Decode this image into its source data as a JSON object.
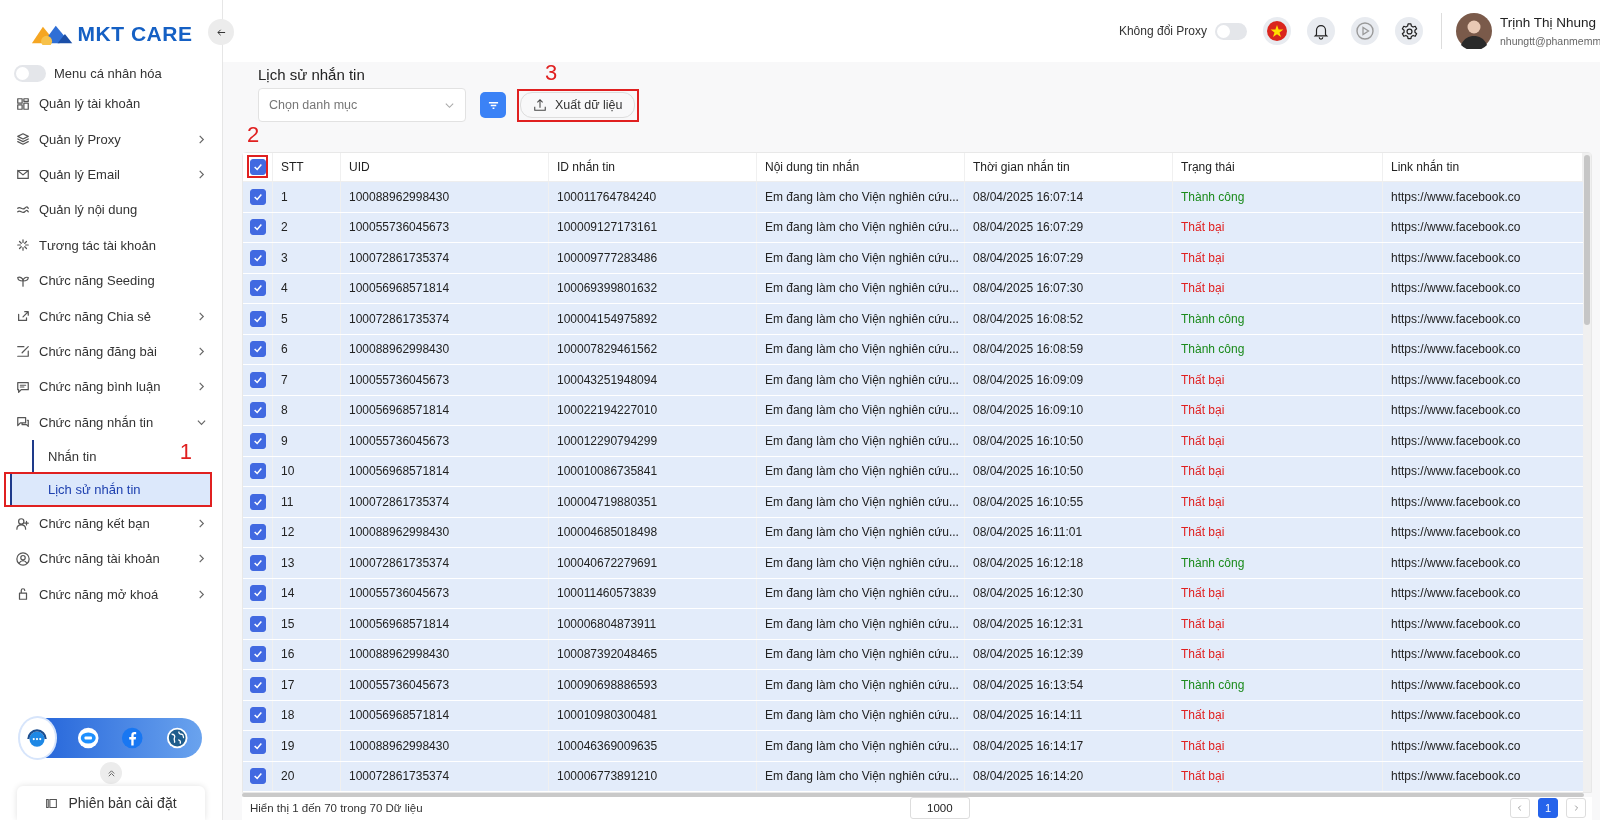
{
  "sidebar": {
    "logo": "MKT CARE",
    "personal_menu": {
      "label": "Menu cá nhân hóa",
      "on": false
    },
    "items": [
      {
        "label": "Quản lý tài khoản",
        "expandable": false
      },
      {
        "label": "Quản lý Proxy",
        "expandable": true,
        "expanded": false
      },
      {
        "label": "Quản lý Email",
        "expandable": true,
        "expanded": false
      },
      {
        "label": "Quản lý nội dung",
        "expandable": false
      },
      {
        "label": "Tương tác tài khoản",
        "expandable": false
      },
      {
        "label": "Chức năng Seeding",
        "expandable": false
      },
      {
        "label": "Chức năng Chia sẻ",
        "expandable": true,
        "expanded": false
      },
      {
        "label": "Chức năng đăng bài",
        "expandable": true,
        "expanded": false
      },
      {
        "label": "Chức năng bình luận",
        "expandable": true,
        "expanded": false
      },
      {
        "label": "Chức năng nhắn tin",
        "expandable": true,
        "expanded": true,
        "children": [
          {
            "label": "Nhắn tin",
            "selected": false
          },
          {
            "label": "Lịch sử nhắn tin",
            "selected": true,
            "callout": "1"
          }
        ]
      },
      {
        "label": "Chức năng kết bạn",
        "expandable": true,
        "expanded": false
      },
      {
        "label": "Chức năng tài khoản",
        "expandable": true,
        "expanded": false
      },
      {
        "label": "Chức năng mở khoá",
        "expandable": true,
        "expanded": false
      }
    ],
    "version_label": "Phiên bản cài đặt"
  },
  "header": {
    "proxy_toggle": {
      "label": "Không đổi Proxy",
      "on": false
    },
    "user": {
      "name": "Trịnh Thị Nhung",
      "email": "nhungtt@phanmemm"
    }
  },
  "page": {
    "title": "Lịch sử nhắn tin",
    "category_select": {
      "placeholder": "Chọn danh mục"
    },
    "export_button": {
      "label": "Xuất dữ liệu",
      "callout": "3"
    }
  },
  "table": {
    "select_all": {
      "checked": true,
      "callout": "2"
    },
    "columns": [
      "STT",
      "UID",
      "ID nhắn tin",
      "Nội dung tin nhắn",
      "Thời gian nhắn tin",
      "Trạng thái",
      "Link nhắn tin"
    ],
    "rows": [
      {
        "checked": true,
        "stt": "1",
        "uid": "100088962998430",
        "msg_id": "100011764784240",
        "content": "Em đang làm cho Viện nghiên cứu...",
        "time": "08/04/2025 16:07:14",
        "status": "Thành công",
        "ok": true,
        "link": "https://www.facebook.co"
      },
      {
        "checked": true,
        "stt": "2",
        "uid": "100055736045673",
        "msg_id": "100009127173161",
        "content": "Em đang làm cho Viện nghiên cứu...",
        "time": "08/04/2025 16:07:29",
        "status": "Thất bại",
        "ok": false,
        "link": "https://www.facebook.co"
      },
      {
        "checked": true,
        "stt": "3",
        "uid": "100072861735374",
        "msg_id": "100009777283486",
        "content": "Em đang làm cho Viện nghiên cứu...",
        "time": "08/04/2025 16:07:29",
        "status": "Thất bại",
        "ok": false,
        "link": "https://www.facebook.co"
      },
      {
        "checked": true,
        "stt": "4",
        "uid": "100056968571814",
        "msg_id": "100069399801632",
        "content": "Em đang làm cho Viện nghiên cứu...",
        "time": "08/04/2025 16:07:30",
        "status": "Thất bại",
        "ok": false,
        "link": "https://www.facebook.co"
      },
      {
        "checked": true,
        "stt": "5",
        "uid": "100072861735374",
        "msg_id": "100004154975892",
        "content": "Em đang làm cho Viện nghiên cứu...",
        "time": "08/04/2025 16:08:52",
        "status": "Thành công",
        "ok": true,
        "link": "https://www.facebook.co"
      },
      {
        "checked": true,
        "stt": "6",
        "uid": "100088962998430",
        "msg_id": "100007829461562",
        "content": "Em đang làm cho Viện nghiên cứu...",
        "time": "08/04/2025 16:08:59",
        "status": "Thành công",
        "ok": true,
        "link": "https://www.facebook.co"
      },
      {
        "checked": true,
        "stt": "7",
        "uid": "100055736045673",
        "msg_id": "100043251948094",
        "content": "Em đang làm cho Viện nghiên cứu...",
        "time": "08/04/2025 16:09:09",
        "status": "Thất bại",
        "ok": false,
        "link": "https://www.facebook.co"
      },
      {
        "checked": true,
        "stt": "8",
        "uid": "100056968571814",
        "msg_id": "100022194227010",
        "content": "Em đang làm cho Viện nghiên cứu...",
        "time": "08/04/2025 16:09:10",
        "status": "Thất bại",
        "ok": false,
        "link": "https://www.facebook.co"
      },
      {
        "checked": true,
        "stt": "9",
        "uid": "100055736045673",
        "msg_id": "100012290794299",
        "content": "Em đang làm cho Viện nghiên cứu...",
        "time": "08/04/2025 16:10:50",
        "status": "Thất bại",
        "ok": false,
        "link": "https://www.facebook.co"
      },
      {
        "checked": true,
        "stt": "10",
        "uid": "100056968571814",
        "msg_id": "100010086735841",
        "content": "Em đang làm cho Viện nghiên cứu...",
        "time": "08/04/2025 16:10:50",
        "status": "Thất bại",
        "ok": false,
        "link": "https://www.facebook.co"
      },
      {
        "checked": true,
        "stt": "11",
        "uid": "100072861735374",
        "msg_id": "100004719880351",
        "content": "Em đang làm cho Viện nghiên cứu...",
        "time": "08/04/2025 16:10:55",
        "status": "Thất bại",
        "ok": false,
        "link": "https://www.facebook.co"
      },
      {
        "checked": true,
        "stt": "12",
        "uid": "100088962998430",
        "msg_id": "100004685018498",
        "content": "Em đang làm cho Viện nghiên cứu...",
        "time": "08/04/2025 16:11:01",
        "status": "Thất bại",
        "ok": false,
        "link": "https://www.facebook.co"
      },
      {
        "checked": true,
        "stt": "13",
        "uid": "100072861735374",
        "msg_id": "100040672279691",
        "content": "Em đang làm cho Viện nghiên cứu...",
        "time": "08/04/2025 16:12:18",
        "status": "Thành công",
        "ok": true,
        "link": "https://www.facebook.co"
      },
      {
        "checked": true,
        "stt": "14",
        "uid": "100055736045673",
        "msg_id": "100011460573839",
        "content": "Em đang làm cho Viện nghiên cứu...",
        "time": "08/04/2025 16:12:30",
        "status": "Thất bại",
        "ok": false,
        "link": "https://www.facebook.co"
      },
      {
        "checked": true,
        "stt": "15",
        "uid": "100056968571814",
        "msg_id": "100006804873911",
        "content": "Em đang làm cho Viện nghiên cứu...",
        "time": "08/04/2025 16:12:31",
        "status": "Thất bại",
        "ok": false,
        "link": "https://www.facebook.co"
      },
      {
        "checked": true,
        "stt": "16",
        "uid": "100088962998430",
        "msg_id": "100087392048465",
        "content": "Em đang làm cho Viện nghiên cứu...",
        "time": "08/04/2025 16:12:39",
        "status": "Thất bại",
        "ok": false,
        "link": "https://www.facebook.co"
      },
      {
        "checked": true,
        "stt": "17",
        "uid": "100055736045673",
        "msg_id": "100090698886593",
        "content": "Em đang làm cho Viện nghiên cứu...",
        "time": "08/04/2025 16:13:54",
        "status": "Thành công",
        "ok": true,
        "link": "https://www.facebook.co"
      },
      {
        "checked": true,
        "stt": "18",
        "uid": "100056968571814",
        "msg_id": "100010980300481",
        "content": "Em đang làm cho Viện nghiên cứu...",
        "time": "08/04/2025 16:14:11",
        "status": "Thất bại",
        "ok": false,
        "link": "https://www.facebook.co"
      },
      {
        "checked": true,
        "stt": "19",
        "uid": "100088962998430",
        "msg_id": "100046369009635",
        "content": "Em đang làm cho Viện nghiên cứu...",
        "time": "08/04/2025 16:14:17",
        "status": "Thất bại",
        "ok": false,
        "link": "https://www.facebook.co"
      },
      {
        "checked": true,
        "stt": "20",
        "uid": "100072861735374",
        "msg_id": "100006773891210",
        "content": "Em đang làm cho Viện nghiên cứu...",
        "time": "08/04/2025 16:14:20",
        "status": "Thất bại",
        "ok": false,
        "link": "https://www.facebook.co"
      }
    ]
  },
  "footer": {
    "summary": "Hiển thị 1 đến 70 trong 70 Dữ liệu",
    "page_size": "1000",
    "pages": [
      {
        "label": "1",
        "selected": true
      }
    ]
  }
}
